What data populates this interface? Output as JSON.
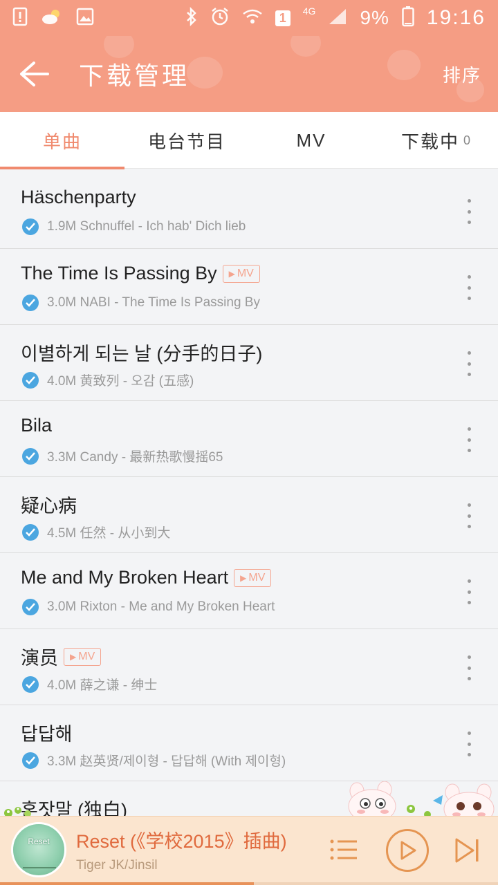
{
  "status_bar": {
    "network_type": "4G",
    "sim_badge": "1",
    "battery_percent": "9%",
    "time": "19:16"
  },
  "app_bar": {
    "title": "下载管理",
    "sort_label": "排序"
  },
  "tabs": [
    {
      "label": "单曲",
      "active": true
    },
    {
      "label": "电台节目",
      "active": false
    },
    {
      "label": "MV",
      "active": false
    },
    {
      "label": "下载中",
      "count": "0",
      "active": false
    }
  ],
  "mv_tag_label": "MV",
  "songs": [
    {
      "title": "Häschenparty",
      "meta": "1.9M Schnuffel - Ich hab' Dich lieb",
      "has_mv": false
    },
    {
      "title": "The Time Is Passing By",
      "meta": "3.0M NABI - The Time Is Passing By",
      "has_mv": true
    },
    {
      "title": "이별하게 되는 날 (分手的日子)",
      "meta": "4.0M 黄致列 - 오감 (五感)",
      "has_mv": false
    },
    {
      "title": "Bila",
      "meta": "3.3M Candy - 最新热歌慢摇65",
      "has_mv": false
    },
    {
      "title": "疑心病",
      "meta": "4.5M 任然 - 从小到大",
      "has_mv": false
    },
    {
      "title": "Me and My Broken Heart",
      "meta": "3.0M Rixton - Me and My Broken Heart",
      "has_mv": true
    },
    {
      "title": "演员",
      "meta": "4.0M 薛之谦 - 绅士",
      "has_mv": true
    },
    {
      "title": "답답해",
      "meta": "3.3M 赵英贤/제이형 - 답답해 (With 제이형)",
      "has_mv": false
    },
    {
      "title": "혼잣말 (独白)",
      "meta": "",
      "has_mv": false
    }
  ],
  "player": {
    "title": "Reset (《学校2015》插曲)",
    "artist": "Tiger JK/Jinsil",
    "album_art_text": "Reset",
    "progress": 0.51
  },
  "colors": {
    "header": "#f59d84",
    "accent": "#f08a6e",
    "check": "#4ba6e0",
    "player_bg": "#fbe5cf",
    "player_accent": "#e59552"
  }
}
